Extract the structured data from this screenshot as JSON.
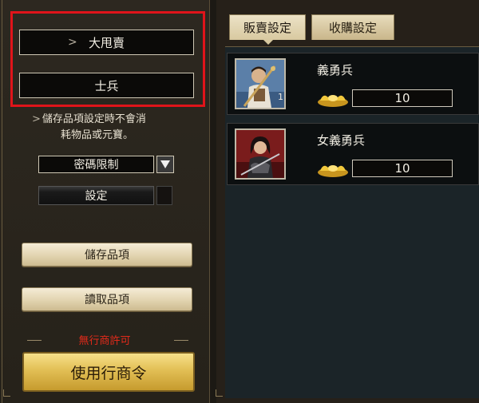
{
  "left_panel": {
    "category_select": {
      "value": "大甩賣",
      "chevron": ">"
    },
    "type_select": {
      "value": "士兵"
    },
    "note_arrow": ">",
    "note_line1": "儲存品項設定時不會消",
    "note_line2": "耗物品或元寶。",
    "password_dropdown": {
      "value": "密碼限制",
      "arrow_icon": "triangle-down-icon"
    },
    "set_button_label": "設定",
    "save_items_label": "儲存品項",
    "load_items_label": "讀取品項",
    "no_license_text": "無行商許可",
    "use_license_label": "使用行商令"
  },
  "right_panel": {
    "tabs": [
      {
        "label": "販賣設定",
        "active": true
      },
      {
        "label": "收購設定",
        "active": false
      }
    ],
    "items": [
      {
        "name": "義勇兵",
        "count": "1",
        "price": "10",
        "portrait_icon": "militia-soldier-portrait",
        "currency_icon": "gold-ingot-icon"
      },
      {
        "name": "女義勇兵",
        "count": "",
        "price": "10",
        "portrait_icon": "female-militia-portrait",
        "currency_icon": "gold-ingot-icon"
      }
    ]
  },
  "colors": {
    "highlight_box": "#e0141a",
    "warning_text": "#e02a1a",
    "gold_button": "#e2bf55"
  }
}
